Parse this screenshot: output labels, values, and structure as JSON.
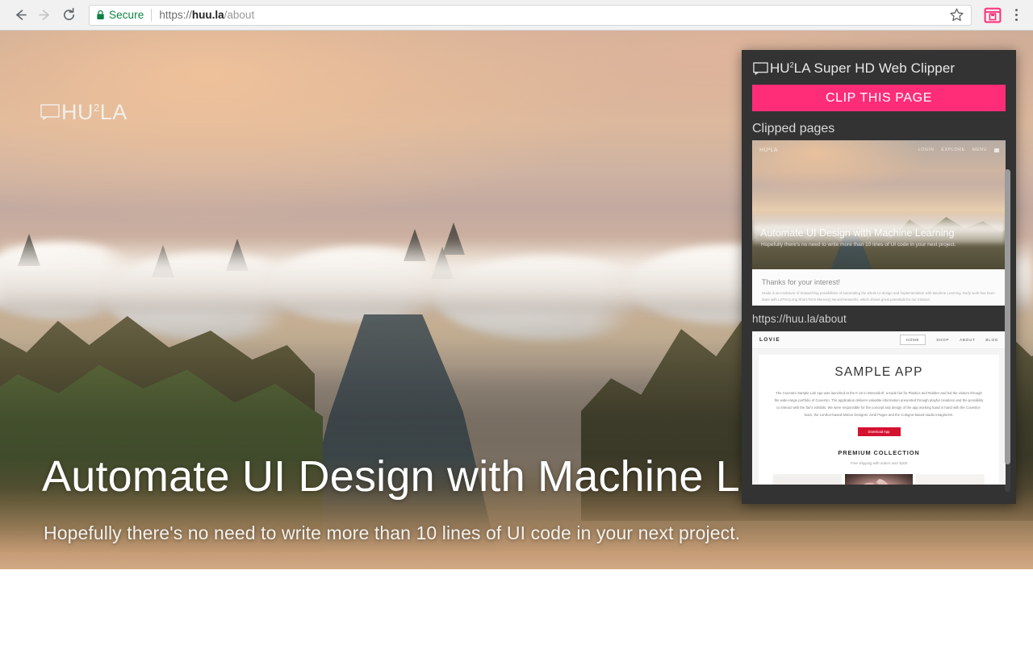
{
  "browser": {
    "back_icon": "back-arrow-icon",
    "forward_icon": "forward-arrow-icon",
    "reload_icon": "reload-icon",
    "security_label": "Secure",
    "lock_icon": "lock-icon",
    "url_scheme": "https://",
    "url_domain": "huu.la",
    "url_path": "/about",
    "url_full": "https://huu.la/about",
    "bookmark_icon": "star-icon",
    "extension_icon": "web-clipper-extension-icon",
    "menu_icon": "kebab-menu-icon",
    "extension_accent": "#FF2D78"
  },
  "page": {
    "logo_mark": "screen-outline-icon",
    "logo_text": "HU",
    "logo_sup": "2",
    "logo_text_end": "LA",
    "hero_title": "Automate UI Design with Machine Le",
    "hero_subtitle": "Hopefully there's no need to write more than 10 lines of UI code in your next project."
  },
  "popup": {
    "logo_mark": "screen-outline-icon",
    "title_brand": "HU",
    "title_sup": "2",
    "title_brand_end": "LA",
    "title_rest": " Super HD Web Clipper",
    "clip_button_label": "CLIP THIS PAGE",
    "clip_button_color": "#FF2D78",
    "background_color": "#333333",
    "section_label": "Clipped pages",
    "scrollbar": "vertical-scrollbar",
    "clips": [
      {
        "url": "https://huu.la/about",
        "thumb": {
          "logo": "HU²LA",
          "nav": [
            "LOGIN",
            "EXPLORE",
            "MENU"
          ],
          "menu_icon": "hamburger-icon",
          "hero_title": "Automate UI Design with Machine Learning",
          "hero_subtitle": "Hopefully there's no need to write more than 10 lines of UI code in your next project.",
          "section_heading": "Thanks for your interest!",
          "body_text": "Huula is an endeavor of researching possibilities of automating the whole UI design and implementation with Machine Learning. Early work has been done with LSTM (Long Short-Term Memory) Neural Networks, which shows great potentials for our mission."
        }
      },
      {
        "thumb": {
          "logo": "LOVIE",
          "nav": [
            "HOME",
            "SHOP",
            "ABOUT",
            "BLOG"
          ],
          "nav_active": "HOME",
          "heading": "SAMPLE APP",
          "body_text": "The Covestro Sample Lab App was launched at the K 16 in Düsseldorf, a trade fair for Plastics and Rubber and led the visitors through the wide-range portfolio of Covestro. The application delivers valuable information presented through playful creations and the possibility to interact with the fair's exhibits. We were responsible for the concept and design of the app working hand in hand with the Covestro-team, the London-based Motion Designer Jordi Pages and the Cologne-based studio ImagineOn.",
          "download_label": "Download App",
          "download_color": "#d51130",
          "collection_heading": "PREMIUM COLLECTION",
          "collection_note": "Free shipping with orders over $200"
        }
      }
    ]
  }
}
